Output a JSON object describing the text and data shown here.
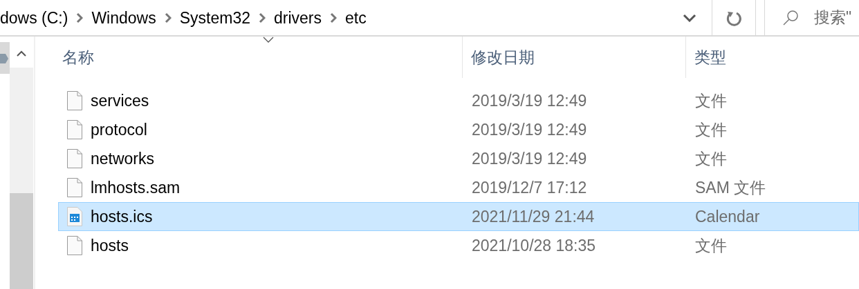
{
  "breadcrumb": [
    "dows (C:)",
    "Windows",
    "System32",
    "drivers",
    "etc"
  ],
  "search": {
    "placeholder": "搜索\""
  },
  "columns": [
    {
      "label": "名称",
      "sorted": true
    },
    {
      "label": "修改日期",
      "sorted": false
    },
    {
      "label": "类型",
      "sorted": false
    }
  ],
  "files": [
    {
      "name": "services",
      "modified": "2019/3/19 12:49",
      "type": "文件",
      "kind": "file",
      "selected": false
    },
    {
      "name": "protocol",
      "modified": "2019/3/19 12:49",
      "type": "文件",
      "kind": "file",
      "selected": false
    },
    {
      "name": "networks",
      "modified": "2019/3/19 12:49",
      "type": "文件",
      "kind": "file",
      "selected": false
    },
    {
      "name": "lmhosts.sam",
      "modified": "2019/12/7 17:12",
      "type": "SAM 文件",
      "kind": "file",
      "selected": false
    },
    {
      "name": "hosts.ics",
      "modified": "2021/11/29 21:44",
      "type": "Calendar",
      "kind": "calendar",
      "selected": true
    },
    {
      "name": "hosts",
      "modified": "2021/10/28 18:35",
      "type": "文件",
      "kind": "file",
      "selected": false
    }
  ]
}
